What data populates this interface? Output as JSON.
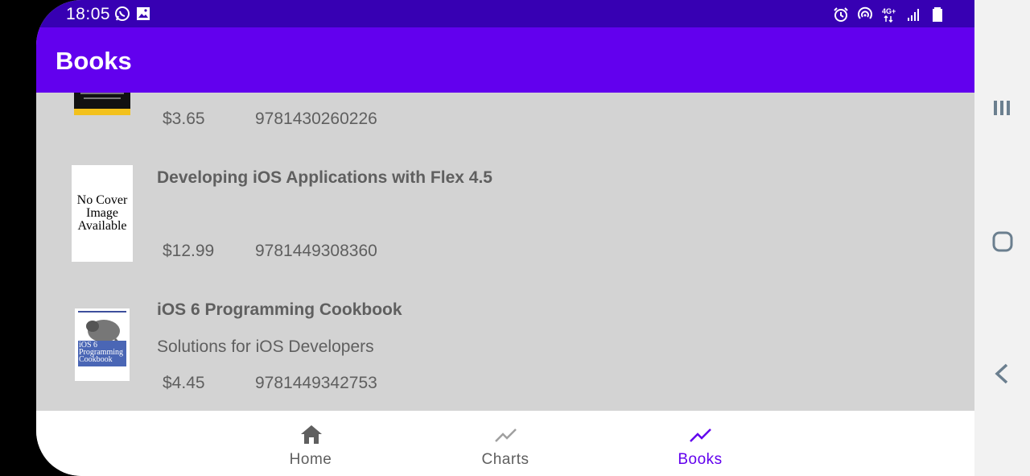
{
  "status_bar": {
    "time": "18:05",
    "left_icons": [
      "whatsapp-icon",
      "image-icon"
    ],
    "right_icons": [
      "alarm-icon",
      "hotspot-icon",
      "network-4g-icon",
      "signal-icon",
      "battery-icon"
    ],
    "network_label": "4G+"
  },
  "app_bar": {
    "title": "Books"
  },
  "books": [
    {
      "title": "",
      "subtitle": "",
      "price": "$3.65",
      "isbn": "9781430260226",
      "cover": "partial-cover"
    },
    {
      "title": "Developing iOS Applications with Flex 4.5",
      "subtitle": "",
      "price": "$12.99",
      "isbn": "9781449308360",
      "cover_text": "No Cover Image Available",
      "cover": "no-cover"
    },
    {
      "title": "iOS 6 Programming Cookbook",
      "subtitle": "Solutions for iOS Developers",
      "price": "$4.45",
      "isbn": "9781449342753",
      "cover": "ios6-cover",
      "cover_text": "iOS 6 Programming Cookbook"
    }
  ],
  "bottom_nav": {
    "items": [
      {
        "label": "Home",
        "icon": "home-icon",
        "active": false
      },
      {
        "label": "Charts",
        "icon": "trending-up-icon",
        "active": false
      },
      {
        "label": "Books",
        "icon": "trending-up-icon",
        "active": true
      }
    ]
  },
  "colors": {
    "status_bar": "#3700b3",
    "app_bar": "#6200ee",
    "list_background": "#d3d3d3",
    "active_nav": "#6200ee",
    "inactive_nav": "#5f5f5f"
  },
  "side_panel": {
    "buttons": [
      "recent-apps-icon",
      "home-circle-icon",
      "back-icon"
    ]
  }
}
